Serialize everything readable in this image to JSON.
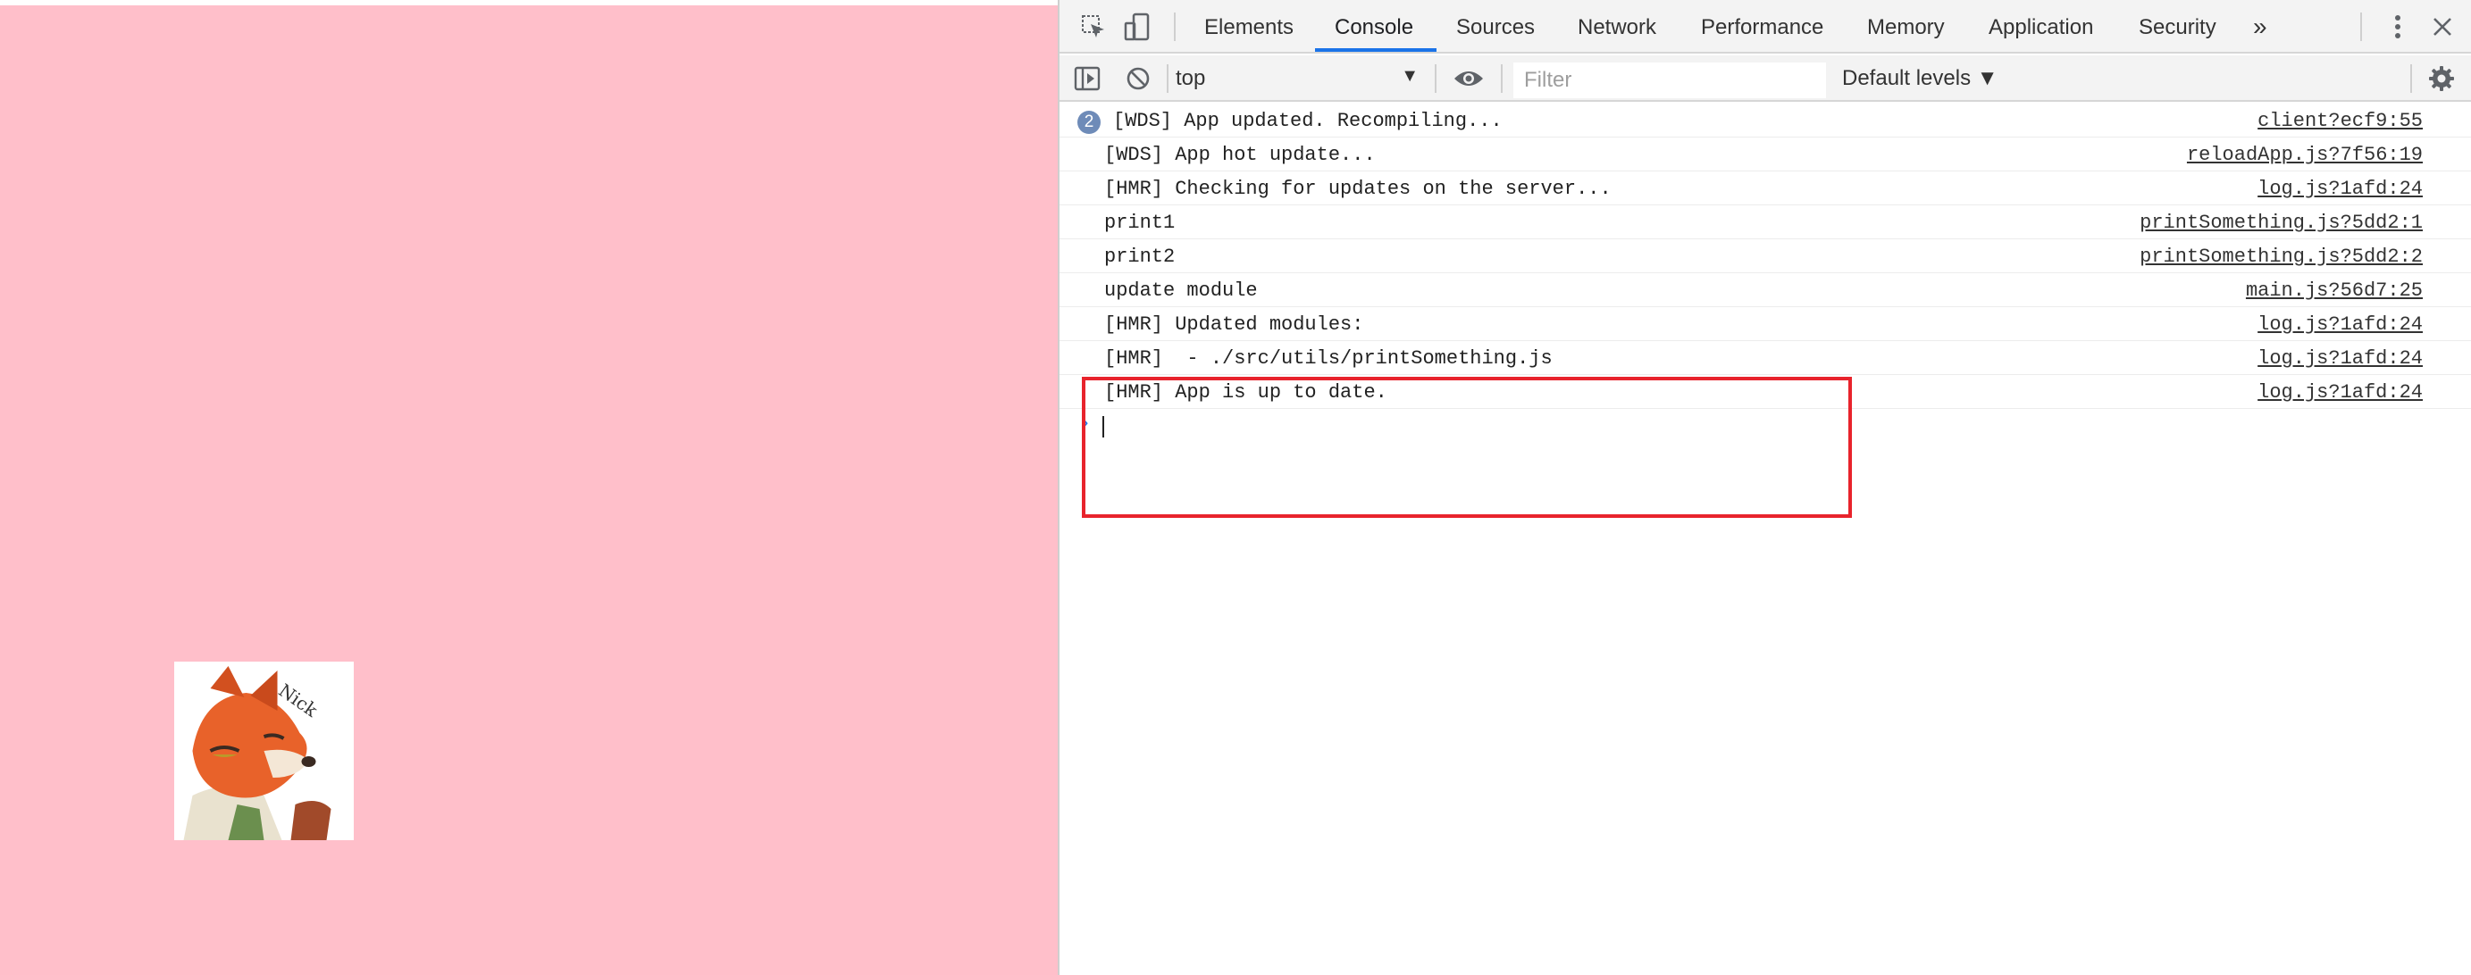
{
  "devtools": {
    "tabs": [
      {
        "label": "Elements",
        "active": false
      },
      {
        "label": "Console",
        "active": true
      },
      {
        "label": "Sources",
        "active": false
      },
      {
        "label": "Network",
        "active": false
      },
      {
        "label": "Performance",
        "active": false
      },
      {
        "label": "Memory",
        "active": false
      },
      {
        "label": "Application",
        "active": false
      },
      {
        "label": "Security",
        "active": false
      }
    ],
    "more_tabs_label": "»",
    "icons": [
      "inspect-element-icon",
      "device-toolbar-icon",
      "kebab-menu-icon",
      "close-icon"
    ]
  },
  "console_toolbar": {
    "context": "top",
    "filter_placeholder": "Filter",
    "filter_value": "",
    "levels": "Default levels ▼",
    "icons": [
      "sidebar-toggle-icon",
      "clear-console-icon",
      "eye-icon",
      "settings-gear-icon"
    ]
  },
  "console": {
    "messages": [
      {
        "count": "2",
        "text": "[WDS] App updated. Recompiling...",
        "source": "client?ecf9:55"
      },
      {
        "text": "[WDS] App hot update...",
        "source": "reloadApp.js?7f56:19"
      },
      {
        "text": "[HMR] Checking for updates on the server...",
        "source": "log.js?1afd:24"
      },
      {
        "text": "print1",
        "source": "printSomething.js?5dd2:1"
      },
      {
        "text": "print2",
        "source": "printSomething.js?5dd2:2"
      },
      {
        "text": "update module",
        "source": "main.js?56d7:25"
      },
      {
        "text": "[HMR] Updated modules:",
        "source": "log.js?1afd:24"
      },
      {
        "text": "[HMR]  - ./src/utils/printSomething.js",
        "source": "log.js?1afd:24"
      },
      {
        "text": "[HMR] App is up to date.",
        "source": "log.js?1afd:24"
      }
    ],
    "prompt": "›"
  },
  "annotation": {
    "color": "#e8232c"
  },
  "page": {
    "background": "#ffbfca"
  }
}
